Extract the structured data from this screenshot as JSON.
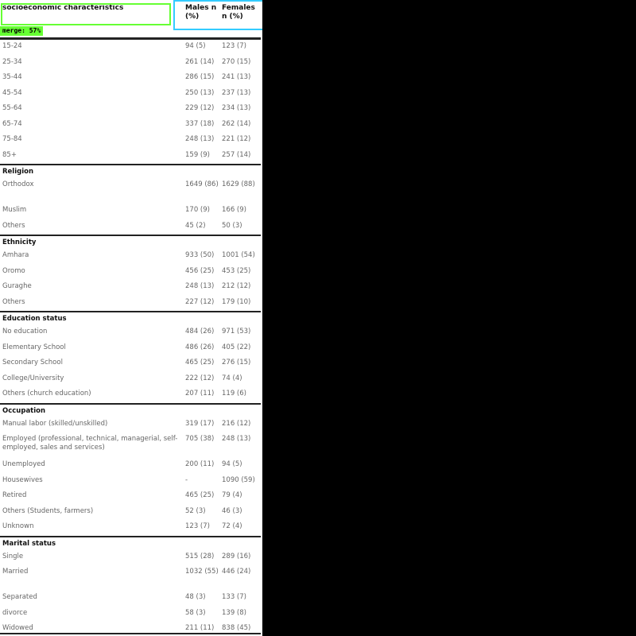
{
  "header": {
    "label": "socioeconomic characteristics",
    "males": "Males n (%)",
    "females": "Females n (%)"
  },
  "overlay": {
    "merge_tag": "merge: 57%",
    "colors": {
      "green": "#66ff33",
      "cyan": "#33ccff"
    }
  },
  "sections": [
    {
      "title": "",
      "rows": [
        {
          "label": "15-24",
          "males": "94 (5)",
          "females": "123 (7)"
        },
        {
          "label": "25-34",
          "males": "261 (14)",
          "females": "270 (15)"
        },
        {
          "label": "35-44",
          "males": "286 (15)",
          "females": "241 (13)"
        },
        {
          "label": "45-54",
          "males": "250 (13)",
          "females": "237 (13)"
        },
        {
          "label": "55-64",
          "males": "229 (12)",
          "females": "234 (13)"
        },
        {
          "label": "65-74",
          "males": "337 (18)",
          "females": "262 (14)"
        },
        {
          "label": "75-84",
          "males": "248 (13)",
          "females": "221 (12)"
        },
        {
          "label": "85+",
          "males": "159 (9)",
          "females": "257 (14)"
        }
      ]
    },
    {
      "title": "Religion",
      "rows": [
        {
          "label": "Orthodox",
          "males": "1649 (86)",
          "females": "1629 (88)"
        },
        {
          "label": "Muslim",
          "males": "170 (9)",
          "females": "166 (9)"
        },
        {
          "label": "Others",
          "males": "45 (2)",
          "females": "50 (3)"
        }
      ]
    },
    {
      "title": "Ethnicity",
      "rows": [
        {
          "label": "Amhara",
          "males": "933 (50)",
          "females": "1001 (54)"
        },
        {
          "label": "Oromo",
          "males": "456 (25)",
          "females": "453 (25)"
        },
        {
          "label": "Guraghe",
          "males": "248 (13)",
          "females": "212 (12)"
        },
        {
          "label": "Others",
          "males": "227 (12)",
          "females": "179 (10)"
        }
      ]
    },
    {
      "title": "Education status",
      "rows": [
        {
          "label": "No education",
          "males": "484 (26)",
          "females": "971 (53)"
        },
        {
          "label": "Elementary School",
          "males": "486 (26)",
          "females": "405 (22)"
        },
        {
          "label": "Secondary School",
          "males": "465 (25)",
          "females": "276 (15)"
        },
        {
          "label": "College/University",
          "males": "222 (12)",
          "females": "74 (4)"
        },
        {
          "label": "Others (church education)",
          "males": "207 (11)",
          "females": "119 (6)"
        }
      ]
    },
    {
      "title": "Occupation",
      "rows": [
        {
          "label": "Manual labor (skilled/unskilled)",
          "males": "319 (17)",
          "females": "216 (12)"
        },
        {
          "label": "Employed (professional, technical, managerial, self-employed, sales and services)",
          "males": "705 (38)",
          "females": "248 (13)"
        },
        {
          "label": "Unemployed",
          "males": "200 (11)",
          "females": "94 (5)"
        },
        {
          "label": "Housewives",
          "males": "-",
          "females": "1090 (59)"
        },
        {
          "label": "Retired",
          "males": "465 (25)",
          "females": "79 (4)"
        },
        {
          "label": "Others (Students, farmers)",
          "males": "52 (3)",
          "females": "46 (3)"
        },
        {
          "label": "Unknown",
          "males": "123 (7)",
          "females": "72 (4)"
        }
      ]
    },
    {
      "title": "Marital status",
      "rows": [
        {
          "label": "Single",
          "males": "515 (28)",
          "females": "289 (16)"
        },
        {
          "label": "Married",
          "males": "1032 (55)",
          "females": "446 (24)"
        },
        {
          "label": "Separated",
          "males": "48 (3)",
          "females": "133 (7)"
        },
        {
          "label": "divorce",
          "males": "58 (3)",
          "females": "139 (8)"
        },
        {
          "label": "Widowed",
          "males": "211 (11)",
          "females": "838 (45)"
        }
      ]
    }
  ]
}
